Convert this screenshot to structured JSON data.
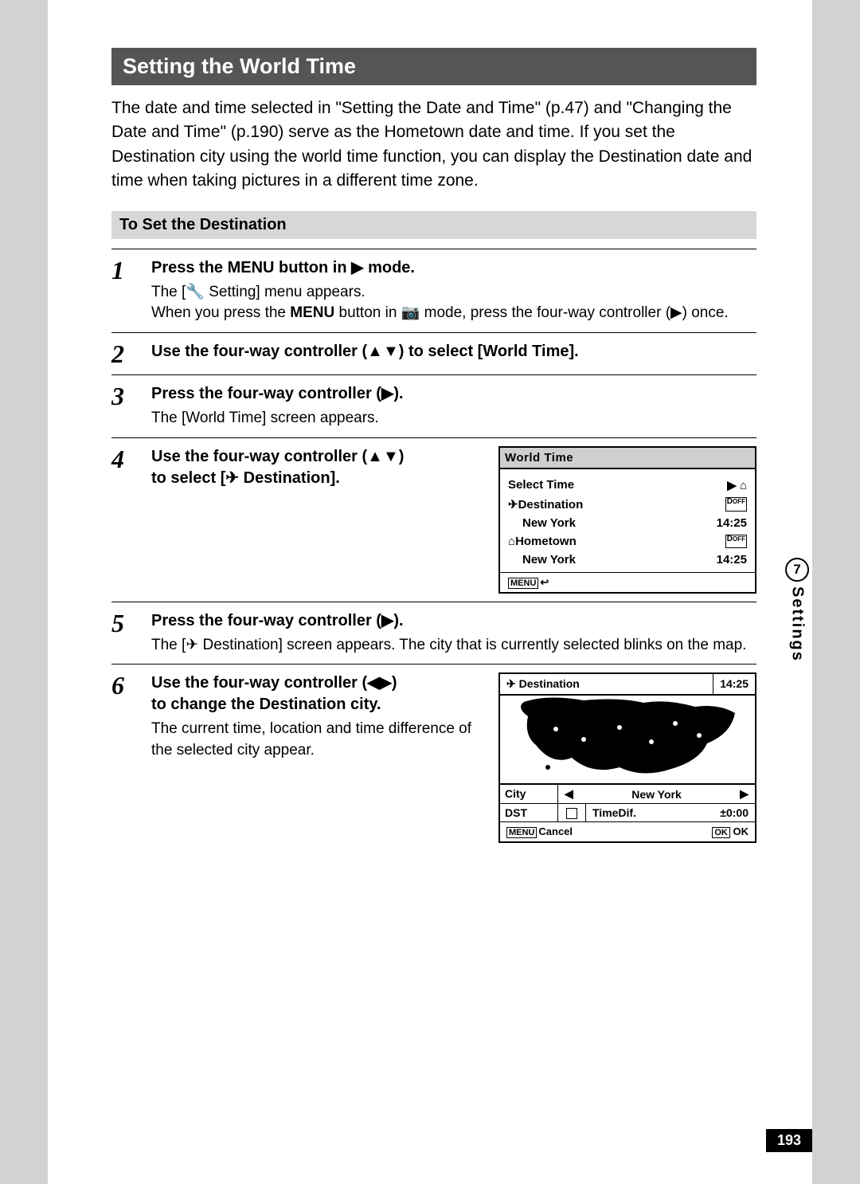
{
  "section": {
    "title": "Setting the World Time",
    "intro": "The date and time selected in \"Setting the Date and Time\" (p.47) and \"Changing the Date and Time\" (p.190) serve as the Hometown date and time. If you set the Destination city using the world time function, you can display the Destination date and time when taking pictures in a different time zone.",
    "subheading": "To Set the Destination"
  },
  "steps": {
    "s1": {
      "num": "1",
      "title_pre": "Press the ",
      "title_menu": "MENU",
      "title_mid": " button in ",
      "title_post": " mode.",
      "desc1_pre": "The [",
      "desc1_post": " Setting] menu appears.",
      "desc2_pre": "When you press the ",
      "desc2_menu": "MENU",
      "desc2_mid": " button in ",
      "desc2_post": " mode, press the four-way controller (▶) once."
    },
    "s2": {
      "num": "2",
      "title": "Use the four-way controller (▲▼) to select [World Time]."
    },
    "s3": {
      "num": "3",
      "title": "Press the four-way controller (▶).",
      "desc": "The [World Time] screen appears."
    },
    "s4": {
      "num": "4",
      "title_line1": "Use the four-way controller (▲▼)",
      "title_line2_pre": "to select [",
      "title_line2_post": " Destination]."
    },
    "s5": {
      "num": "5",
      "title": "Press the four-way controller (▶).",
      "desc_pre": "The [",
      "desc_post": " Destination] screen appears. The city that is currently selected blinks on the map."
    },
    "s6": {
      "num": "6",
      "title_line1": "Use the four-way controller (◀▶)",
      "title_line2": "to change the Destination city.",
      "desc": "The current time, location and time difference of the selected city appear."
    }
  },
  "screenshot1": {
    "title": "World Time",
    "select_time": "Select Time",
    "select_ptr": "▶",
    "dest_label": "Destination",
    "dest_city": "New York",
    "dest_time": "14:25",
    "dest_dst": "DST OFF",
    "home_label": "Hometown",
    "home_city": "New York",
    "home_time": "14:25",
    "home_dst": "DST OFF",
    "menu_label": "MENU",
    "back_icon": "↩"
  },
  "screenshot2": {
    "dest_label": "Destination",
    "time": "14:25",
    "city_label": "City",
    "city_value": "New York",
    "dst_label": "DST",
    "timedif_label": "TimeDif.",
    "timedif_value": "±0:00",
    "menu_label": "MENU",
    "cancel": "Cancel",
    "ok_box": "OK",
    "ok_label": "OK"
  },
  "tab": {
    "chapter": "7",
    "label": "Settings"
  },
  "page_number": "193"
}
